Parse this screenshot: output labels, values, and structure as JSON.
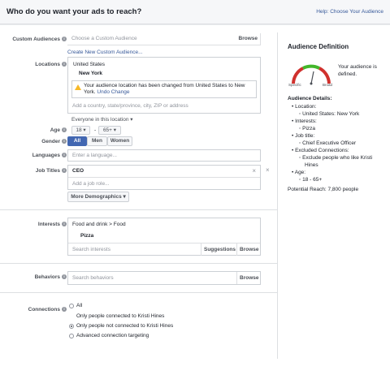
{
  "header": {
    "title": "Who do you want your ads to reach?",
    "help_link": "Help: Choose Your Audience"
  },
  "custom_audiences": {
    "label": "Custom Audiences",
    "placeholder": "Choose a Custom Audience",
    "browse": "Browse",
    "create_link": "Create New Custom Audience..."
  },
  "locations": {
    "label": "Locations",
    "country": "United States",
    "city": "New York",
    "warning": "Your audience location has been changed from United States to New York.",
    "undo": "Undo Change",
    "placeholder": "Add a country, state/province, city, ZIP or address",
    "scope": "Everyone in this location"
  },
  "age": {
    "label": "Age",
    "min": "18",
    "max": "65+",
    "dash": "-"
  },
  "gender": {
    "label": "Gender",
    "options": [
      "All",
      "Men",
      "Women"
    ]
  },
  "languages": {
    "label": "Languages",
    "placeholder": "Enter a language..."
  },
  "job_titles": {
    "label": "Job Titles",
    "value": "CEO",
    "placeholder": "Add a job role...",
    "clear": "×",
    "remove": "×",
    "more_demographics": "More Demographics"
  },
  "interests": {
    "label": "Interests",
    "path": "Food and drink > Food",
    "item": "Pizza",
    "placeholder": "Search interests",
    "suggestions": "Suggestions",
    "browse": "Browse"
  },
  "behaviors": {
    "label": "Behaviors",
    "placeholder": "Search behaviors",
    "browse": "Browse"
  },
  "connections": {
    "label": "Connections",
    "options": [
      {
        "label": "All",
        "selected": false,
        "radio": true
      },
      {
        "label": "Only people connected to Kristi Hines",
        "selected": false,
        "radio": false
      },
      {
        "label": "Only people not connected to Kristi Hines",
        "selected": true,
        "radio": true
      },
      {
        "label": "Advanced connection targeting",
        "selected": false,
        "radio": true
      }
    ]
  },
  "audience_definition": {
    "title": "Audience Definition",
    "defined_text_1": "Your audience is",
    "defined_text_2": "defined.",
    "specific": "Specific",
    "broad": "Broad",
    "details_title": "Audience Details:",
    "details": [
      {
        "key": "Location:",
        "sub": [
          "United States: New York"
        ]
      },
      {
        "key": "Interests:",
        "sub": [
          "Pizza"
        ]
      },
      {
        "key": "Job title:",
        "sub": [
          "Chief Executive Officer"
        ]
      },
      {
        "key": "Excluded Connections:",
        "sub": [
          "Exclude people who like Kristi",
          "Hines"
        ]
      },
      {
        "key": "Age:",
        "sub": [
          "18 - 65+"
        ]
      }
    ],
    "potential_reach": "Potential Reach: 7,800 people"
  },
  "colors": {
    "accent": "#4267b2",
    "link": "#365899",
    "gauge_green": "#42b72a",
    "gauge_red": "#d0312d",
    "warning": "#f7b928"
  }
}
